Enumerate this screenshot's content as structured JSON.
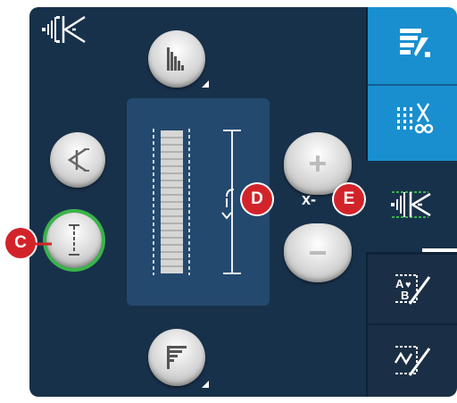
{
  "tabs": [
    {
      "name": "stitch-menu-tab",
      "icon": "stitch-menu-icon"
    },
    {
      "name": "stitch-techniques-tab",
      "icon": "cut-stitch-icon"
    },
    {
      "name": "stitch-settings-tab",
      "icon": "stitch-width-density-icon"
    },
    {
      "name": "sequencing-tab",
      "icon": "abc-sequence-icon"
    },
    {
      "name": "stitch-program-tab",
      "icon": "stitch-program-icon"
    }
  ],
  "markers": {
    "c": "C",
    "d": "D",
    "e": "E"
  },
  "xminus": "x-",
  "colors": {
    "accent": "#1a8fcf",
    "marker": "#d3232a",
    "active_ring": "#3ab44a",
    "panel": "#18314b"
  }
}
